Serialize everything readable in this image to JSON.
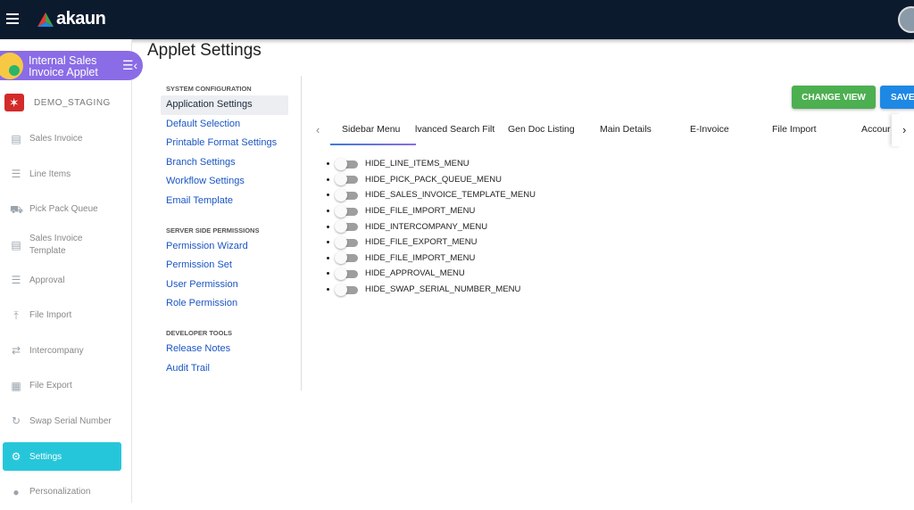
{
  "header": {
    "logo_text": "akaun"
  },
  "applet": {
    "name_line1": "Internal Sales",
    "name_line2": "Invoice Applet"
  },
  "org": {
    "name": "DEMO_STAGING"
  },
  "sidebar": {
    "items": [
      {
        "label": "Sales Invoice",
        "icon": "invoice-icon"
      },
      {
        "label": "Line Items",
        "icon": "list-icon"
      },
      {
        "label": "Pick Pack Queue",
        "icon": "truck-icon"
      },
      {
        "label": "Sales Invoice Template",
        "icon": "document-icon"
      },
      {
        "label": "Approval",
        "icon": "list-icon"
      },
      {
        "label": "File Import",
        "icon": "upload-icon"
      },
      {
        "label": "Intercompany",
        "icon": "swap-arrows-icon"
      },
      {
        "label": "File Export",
        "icon": "table-icon"
      },
      {
        "label": "Swap Serial Number",
        "icon": "refresh-icon"
      },
      {
        "label": "Settings",
        "icon": "gear-icon",
        "active": true
      },
      {
        "label": "Personalization",
        "icon": "person-icon"
      }
    ]
  },
  "page": {
    "title": "Applet Settings"
  },
  "settings_nav": {
    "system": {
      "heading": "SYSTEM CONFIGURATION",
      "links": [
        "Application Settings",
        "Default Selection",
        "Printable Format Settings",
        "Branch Settings",
        "Workflow Settings",
        "Email Template"
      ]
    },
    "server": {
      "heading": "SERVER SIDE PERMISSIONS",
      "links": [
        "Permission Wizard",
        "Permission Set",
        "User Permission",
        "Role Permission"
      ]
    },
    "dev": {
      "heading": "DEVELOPER TOOLS",
      "links": [
        "Release Notes",
        "Audit Trail"
      ]
    }
  },
  "buttons": {
    "change_view": "CHANGE VIEW",
    "save": "SAVE"
  },
  "tabs": [
    "Sidebar Menu",
    "lvanced Search Filt",
    "Gen Doc Listing",
    "Main Details",
    "E-Invoice",
    "File Import",
    "Accour"
  ],
  "toggles": [
    {
      "label": "HIDE_LINE_ITEMS_MENU",
      "on": false
    },
    {
      "label": "HIDE_PICK_PACK_QUEUE_MENU",
      "on": false
    },
    {
      "label": "HIDE_SALES_INVOICE_TEMPLATE_MENU",
      "on": false
    },
    {
      "label": "HIDE_FILE_IMPORT_MENU",
      "on": false
    },
    {
      "label": "HIDE_INTERCOMPANY_MENU",
      "on": false
    },
    {
      "label": "HIDE_FILE_EXPORT_MENU",
      "on": false
    },
    {
      "label": "HIDE_FILE_IMPORT_MENU",
      "on": false
    },
    {
      "label": "HIDE_APPROVAL_MENU",
      "on": false
    },
    {
      "label": "HIDE_SWAP_SERIAL_NUMBER_MENU",
      "on": false
    }
  ],
  "colors": {
    "topbar": "#0c1a2e",
    "applet": "#8a6ce6",
    "active_nav": "#26c6da",
    "change_view": "#4caf50",
    "save": "#1e88e5"
  }
}
